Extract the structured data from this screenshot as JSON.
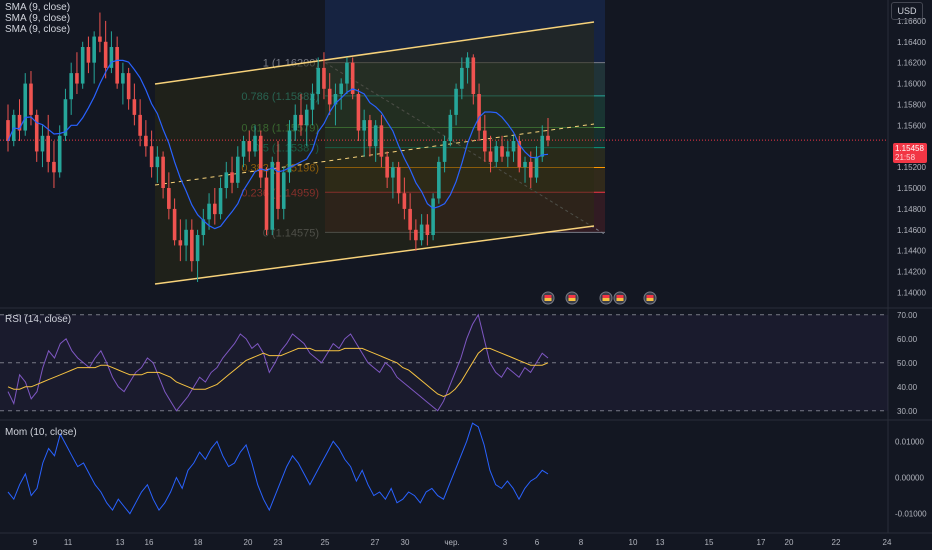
{
  "currency_button": "USD",
  "legend": [
    "SMA (9, close)",
    "SMA (9, close)",
    "SMA (9, close)"
  ],
  "rsi_title": "RSI (14, close)",
  "mom_title": "Mom (10, close)",
  "last_price": {
    "value": "1.15458",
    "countdown": "21:58"
  },
  "colors": {
    "up": "#26a69a",
    "down": "#ef5350",
    "sma": "#2962ff",
    "channel": "#f7d27a",
    "rsi": "#7e57c2",
    "rsi_ma": "#f5c242",
    "mom": "#2962ff"
  },
  "events_icons": [
    "flag-icon",
    "flag-icon",
    "flag-icon",
    "flag-icon",
    "flag-icon"
  ],
  "chart_data": [
    {
      "type": "candlestick",
      "pane": "price",
      "x_tick_labels": [
        "9",
        "11",
        "13",
        "16",
        "18",
        "20",
        "23",
        "25",
        "27",
        "30",
        "чер.",
        "3",
        "6",
        "8",
        "10",
        "13",
        "15",
        "17",
        "20",
        "22",
        "24"
      ],
      "y_tick_labels": [
        "1.16600",
        "1.16400",
        "1.16200",
        "1.16000",
        "1.15800",
        "1.15600",
        "1.15400",
        "1.15200",
        "1.15000",
        "1.14800",
        "1.14600",
        "1.14400",
        "1.14200",
        "1.14000"
      ],
      "ylim": [
        1.1388,
        1.168
      ],
      "fib_levels": [
        {
          "label": "1 (1.16200)",
          "value": 1.162,
          "color": "#787b86"
        },
        {
          "label": "0.786 (1.15882)",
          "value": 1.15882,
          "color": "#26a69a"
        },
        {
          "label": "0.618 (1.15579)",
          "value": 1.15579,
          "color": "#4caf50"
        },
        {
          "label": "0.5 (1.15387)",
          "value": 1.15387,
          "color": "#089981"
        },
        {
          "label": "0.382 (1.15196)",
          "value": 1.15196,
          "color": "#ff9800"
        },
        {
          "label": "0.236 (1.14959)",
          "value": 1.14959,
          "color": "#f23645"
        },
        {
          "label": "0 (1.14575)",
          "value": 1.14575,
          "color": "#787b86"
        }
      ],
      "candles_ohlc": [
        [
          1.1565,
          1.158,
          1.1535,
          1.1545
        ],
        [
          1.1545,
          1.1575,
          1.154,
          1.157
        ],
        [
          1.157,
          1.1585,
          1.1545,
          1.1555
        ],
        [
          1.1555,
          1.161,
          1.155,
          1.16
        ],
        [
          1.16,
          1.1612,
          1.156,
          1.157
        ],
        [
          1.157,
          1.1575,
          1.1525,
          1.1535
        ],
        [
          1.1535,
          1.156,
          1.152,
          1.155
        ],
        [
          1.155,
          1.157,
          1.1515,
          1.1525
        ],
        [
          1.1525,
          1.1545,
          1.15,
          1.1515
        ],
        [
          1.1515,
          1.156,
          1.151,
          1.155
        ],
        [
          1.155,
          1.1595,
          1.1545,
          1.1585
        ],
        [
          1.1585,
          1.162,
          1.157,
          1.161
        ],
        [
          1.161,
          1.163,
          1.159,
          1.16
        ],
        [
          1.16,
          1.164,
          1.1595,
          1.1635
        ],
        [
          1.1635,
          1.1645,
          1.161,
          1.162
        ],
        [
          1.162,
          1.165,
          1.16,
          1.1645
        ],
        [
          1.1645,
          1.1668,
          1.163,
          1.164
        ],
        [
          1.164,
          1.166,
          1.1605,
          1.1615
        ],
        [
          1.1615,
          1.165,
          1.161,
          1.1635
        ],
        [
          1.1635,
          1.1645,
          1.1595,
          1.16
        ],
        [
          1.16,
          1.162,
          1.158,
          1.161
        ],
        [
          1.161,
          1.1615,
          1.1575,
          1.1585
        ],
        [
          1.1585,
          1.16,
          1.156,
          1.157
        ],
        [
          1.157,
          1.1585,
          1.154,
          1.155
        ],
        [
          1.155,
          1.1565,
          1.153,
          1.154
        ],
        [
          1.154,
          1.1555,
          1.151,
          1.152
        ],
        [
          1.152,
          1.154,
          1.1505,
          1.153
        ],
        [
          1.153,
          1.1535,
          1.149,
          1.15
        ],
        [
          1.15,
          1.1515,
          1.147,
          1.148
        ],
        [
          1.148,
          1.149,
          1.1445,
          1.145
        ],
        [
          1.145,
          1.147,
          1.143,
          1.1445
        ],
        [
          1.1445,
          1.147,
          1.143,
          1.146
        ],
        [
          1.146,
          1.147,
          1.142,
          1.143
        ],
        [
          1.143,
          1.146,
          1.141,
          1.1455
        ],
        [
          1.1455,
          1.148,
          1.1445,
          1.147
        ],
        [
          1.147,
          1.1495,
          1.146,
          1.1485
        ],
        [
          1.1485,
          1.15,
          1.1465,
          1.1475
        ],
        [
          1.1475,
          1.151,
          1.147,
          1.15
        ],
        [
          1.15,
          1.1525,
          1.149,
          1.1515
        ],
        [
          1.1515,
          1.153,
          1.1495,
          1.1505
        ],
        [
          1.1505,
          1.154,
          1.15,
          1.153
        ],
        [
          1.153,
          1.155,
          1.152,
          1.1545
        ],
        [
          1.1545,
          1.1555,
          1.1525,
          1.1535
        ],
        [
          1.1535,
          1.156,
          1.153,
          1.155
        ],
        [
          1.155,
          1.1555,
          1.15,
          1.151
        ],
        [
          1.151,
          1.152,
          1.1455,
          1.146
        ],
        [
          1.146,
          1.153,
          1.1455,
          1.1525
        ],
        [
          1.1525,
          1.1545,
          1.147,
          1.148
        ],
        [
          1.148,
          1.152,
          1.147,
          1.1515
        ],
        [
          1.1515,
          1.1565,
          1.1505,
          1.1555
        ],
        [
          1.1555,
          1.158,
          1.1545,
          1.157
        ],
        [
          1.157,
          1.159,
          1.155,
          1.156
        ],
        [
          1.156,
          1.158,
          1.154,
          1.1575
        ],
        [
          1.1575,
          1.16,
          1.156,
          1.159
        ],
        [
          1.159,
          1.1625,
          1.158,
          1.1615
        ],
        [
          1.1615,
          1.163,
          1.1585,
          1.1595
        ],
        [
          1.1595,
          1.161,
          1.157,
          1.158
        ],
        [
          1.158,
          1.16,
          1.156,
          1.159
        ],
        [
          1.159,
          1.1605,
          1.1575,
          1.16
        ],
        [
          1.16,
          1.1625,
          1.159,
          1.162
        ],
        [
          1.162,
          1.1625,
          1.1585,
          1.159
        ],
        [
          1.159,
          1.1595,
          1.1545,
          1.1555
        ],
        [
          1.1555,
          1.1575,
          1.153,
          1.1565
        ],
        [
          1.1565,
          1.157,
          1.153,
          1.154
        ],
        [
          1.154,
          1.1565,
          1.1525,
          1.156
        ],
        [
          1.156,
          1.157,
          1.152,
          1.153
        ],
        [
          1.153,
          1.1535,
          1.15,
          1.151
        ],
        [
          1.151,
          1.1525,
          1.149,
          1.152
        ],
        [
          1.152,
          1.1525,
          1.1485,
          1.1495
        ],
        [
          1.1495,
          1.151,
          1.147,
          1.148
        ],
        [
          1.148,
          1.1495,
          1.145,
          1.146
        ],
        [
          1.146,
          1.147,
          1.144,
          1.145
        ],
        [
          1.145,
          1.1475,
          1.1445,
          1.1465
        ],
        [
          1.1465,
          1.1475,
          1.1445,
          1.1455
        ],
        [
          1.1455,
          1.1495,
          1.145,
          1.149
        ],
        [
          1.149,
          1.153,
          1.1485,
          1.1525
        ],
        [
          1.1525,
          1.155,
          1.1515,
          1.1545
        ],
        [
          1.1545,
          1.1575,
          1.154,
          1.157
        ],
        [
          1.157,
          1.16,
          1.156,
          1.1595
        ],
        [
          1.1595,
          1.1625,
          1.1585,
          1.1615
        ],
        [
          1.1615,
          1.163,
          1.16,
          1.1625
        ],
        [
          1.1625,
          1.1628,
          1.158,
          1.159
        ],
        [
          1.159,
          1.16,
          1.1545,
          1.1555
        ],
        [
          1.1555,
          1.157,
          1.1525,
          1.1535
        ],
        [
          1.1535,
          1.155,
          1.1515,
          1.1525
        ],
        [
          1.1525,
          1.1545,
          1.152,
          1.154
        ],
        [
          1.154,
          1.155,
          1.1525,
          1.153
        ],
        [
          1.153,
          1.1545,
          1.152,
          1.1535
        ],
        [
          1.1535,
          1.155,
          1.1525,
          1.1545
        ],
        [
          1.1545,
          1.155,
          1.1515,
          1.152
        ],
        [
          1.152,
          1.153,
          1.1505,
          1.1525
        ],
        [
          1.1525,
          1.1535,
          1.15,
          1.151
        ],
        [
          1.151,
          1.154,
          1.1505,
          1.153
        ],
        [
          1.153,
          1.156,
          1.1525,
          1.155
        ],
        [
          1.155,
          1.1567,
          1.154,
          1.15458
        ]
      ],
      "series": [
        {
          "name": "SMA (9, close)"
        }
      ]
    },
    {
      "type": "line",
      "pane": "rsi",
      "y_tick_labels": [
        "70.00",
        "60.00",
        "50.00",
        "40.00",
        "30.00"
      ],
      "ylim": [
        27,
        72
      ],
      "levels": [
        70,
        50,
        30
      ],
      "values": [
        38,
        33,
        45,
        42,
        35,
        38,
        48,
        55,
        52,
        58,
        60,
        55,
        52,
        50,
        48,
        52,
        55,
        50,
        44,
        40,
        38,
        42,
        46,
        48,
        52,
        50,
        44,
        38,
        34,
        30,
        33,
        36,
        40,
        44,
        42,
        46,
        48,
        52,
        55,
        58,
        62,
        60,
        56,
        58,
        54,
        46,
        50,
        55,
        58,
        62,
        60,
        58,
        54,
        52,
        50,
        54,
        58,
        56,
        60,
        62,
        58,
        54,
        50,
        48,
        46,
        50,
        48,
        44,
        42,
        40,
        38,
        36,
        34,
        32,
        30,
        34,
        40,
        46,
        52,
        60,
        66,
        70,
        60,
        50,
        46,
        44,
        48,
        46,
        44,
        48,
        46,
        50,
        54,
        52
      ],
      "ma_values": [
        40,
        39,
        39,
        40,
        40,
        41,
        42,
        43,
        44,
        45,
        46,
        47,
        48,
        48,
        48,
        48,
        49,
        49,
        48,
        47,
        46,
        45,
        45,
        45,
        46,
        46,
        46,
        45,
        44,
        42,
        41,
        40,
        39,
        39,
        39,
        40,
        41,
        43,
        45,
        47,
        49,
        51,
        52,
        53,
        54,
        53,
        53,
        53,
        54,
        55,
        56,
        56,
        56,
        55,
        55,
        55,
        55,
        55,
        56,
        56,
        56,
        56,
        55,
        54,
        53,
        52,
        51,
        50,
        48,
        47,
        45,
        43,
        41,
        39,
        37,
        36,
        37,
        39,
        42,
        46,
        50,
        54,
        56,
        56,
        55,
        54,
        53,
        52,
        51,
        50,
        49,
        49,
        49,
        50
      ]
    },
    {
      "type": "line",
      "pane": "mom",
      "y_tick_labels": [
        "0.01000",
        "0.00000",
        "-0.01000"
      ],
      "ylim": [
        -0.0145,
        0.0145
      ],
      "values": [
        -0.004,
        -0.006,
        -0.002,
        0.001,
        -0.005,
        -0.003,
        0.004,
        0.008,
        0.006,
        0.012,
        0.009,
        0.006,
        0.003,
        0.004,
        0.001,
        -0.002,
        -0.004,
        -0.007,
        -0.009,
        -0.006,
        -0.008,
        -0.01,
        -0.007,
        -0.004,
        -0.002,
        -0.006,
        -0.009,
        -0.007,
        -0.004,
        0.0,
        -0.003,
        0.002,
        0.004,
        0.007,
        0.005,
        0.008,
        0.01,
        0.006,
        0.003,
        0.004,
        0.007,
        0.009,
        0.004,
        -0.002,
        -0.006,
        -0.009,
        -0.005,
        -0.001,
        0.003,
        0.006,
        0.004,
        0.001,
        -0.002,
        0.001,
        0.004,
        0.007,
        0.01,
        0.008,
        0.005,
        0.003,
        -0.001,
        0.002,
        -0.002,
        -0.005,
        -0.004,
        -0.006,
        -0.003,
        -0.007,
        -0.006,
        -0.004,
        -0.005,
        -0.007,
        -0.004,
        -0.003,
        -0.005,
        -0.006,
        -0.002,
        0.002,
        0.006,
        0.01,
        0.015,
        0.014,
        0.009,
        0.002,
        -0.002,
        -0.003,
        -0.001,
        -0.003,
        -0.006,
        -0.003,
        -0.001,
        0.0,
        0.002,
        0.001
      ]
    }
  ]
}
